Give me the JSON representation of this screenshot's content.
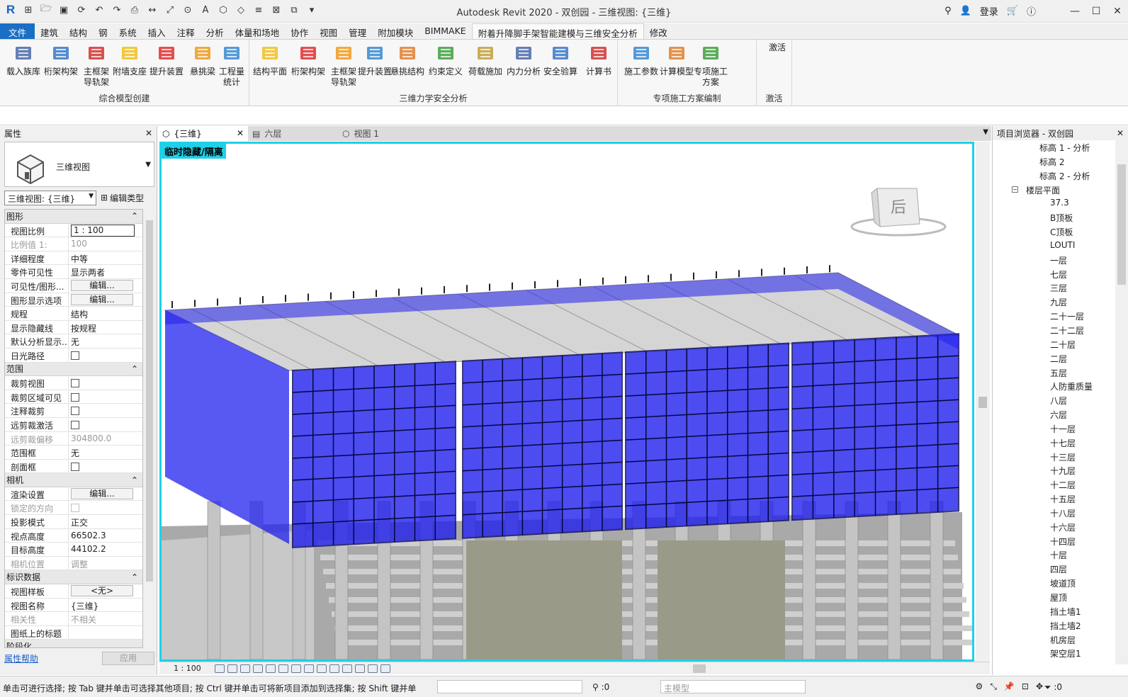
{
  "window": {
    "title": "Autodesk Revit 2020 - 双创园 - 三维视图: {三维}",
    "sign_in": "登录"
  },
  "tabs": [
    "文件",
    "建筑",
    "结构",
    "钢",
    "系统",
    "插入",
    "注释",
    "分析",
    "体量和场地",
    "协作",
    "视图",
    "管理",
    "附加模块",
    "BIMMAKE",
    "附着升降脚手架智能建模与三维安全分析",
    "修改"
  ],
  "ribbon": {
    "groups": [
      {
        "label": "综合模型创建",
        "tools": [
          "载入族库",
          "桁架构架",
          "主框架\n导轨架",
          "附墙支座",
          "提升装置",
          "悬挑梁",
          "工程量\n统计"
        ]
      },
      {
        "label": "三维力学安全分析",
        "tools": [
          "结构平面",
          "桁架构架",
          "主框架\n导轨架",
          "提升装置",
          "悬挑结构",
          "约束定义",
          "荷载施加",
          "内力分析",
          "安全验算",
          "计算书"
        ]
      },
      {
        "label": "专项施工方案编制",
        "tools": [
          "施工参数",
          "计算模型",
          "专项施工方案"
        ]
      },
      {
        "label": "激活",
        "tools": [
          "激活"
        ]
      }
    ]
  },
  "properties": {
    "title": "属性",
    "type_name": "三维视图",
    "instance_selector": "三维视图: {三维}",
    "edit_type": "编辑类型",
    "help": "属性帮助",
    "apply": "应用",
    "sections": [
      {
        "name": "图形",
        "rows": [
          {
            "name": "视图比例",
            "value": "1 : 100",
            "kind": "input"
          },
          {
            "name": "比例值 1:",
            "value": "100",
            "kind": "dim"
          },
          {
            "name": "详细程度",
            "value": "中等"
          },
          {
            "name": "零件可见性",
            "value": "显示两者"
          },
          {
            "name": "可见性/图形...",
            "value": "编辑...",
            "kind": "button"
          },
          {
            "name": "图形显示选项",
            "value": "编辑...",
            "kind": "button"
          },
          {
            "name": "规程",
            "value": "结构"
          },
          {
            "name": "显示隐藏线",
            "value": "按规程"
          },
          {
            "name": "默认分析显示...",
            "value": "无"
          },
          {
            "name": "日光路径",
            "value": "",
            "kind": "check"
          }
        ]
      },
      {
        "name": "范围",
        "rows": [
          {
            "name": "裁剪视图",
            "value": "",
            "kind": "check"
          },
          {
            "name": "裁剪区域可见",
            "value": "",
            "kind": "check"
          },
          {
            "name": "注释裁剪",
            "value": "",
            "kind": "check"
          },
          {
            "name": "远剪裁激活",
            "value": "",
            "kind": "check"
          },
          {
            "name": "远剪裁偏移",
            "value": "304800.0",
            "kind": "dim"
          },
          {
            "name": "范围框",
            "value": "无"
          },
          {
            "name": "剖面框",
            "value": "",
            "kind": "check"
          }
        ]
      },
      {
        "name": "相机",
        "rows": [
          {
            "name": "渲染设置",
            "value": "编辑...",
            "kind": "button"
          },
          {
            "name": "锁定的方向",
            "value": "",
            "kind": "dimcheck"
          },
          {
            "name": "投影模式",
            "value": "正交"
          },
          {
            "name": "视点高度",
            "value": "66502.3"
          },
          {
            "name": "目标高度",
            "value": "44102.2"
          },
          {
            "name": "相机位置",
            "value": "调整",
            "kind": "dim"
          }
        ]
      },
      {
        "name": "标识数据",
        "rows": [
          {
            "name": "视图样板",
            "value": "<无>",
            "kind": "button"
          },
          {
            "name": "视图名称",
            "value": "{三维}"
          },
          {
            "name": "相关性",
            "value": "不相关",
            "kind": "dim"
          },
          {
            "name": "图纸上的标题",
            "value": ""
          }
        ]
      },
      {
        "name": "阶段化",
        "rows": []
      }
    ]
  },
  "view_tabs": [
    {
      "label": "{三维}",
      "active": true
    },
    {
      "label": "六层",
      "active": false
    },
    {
      "label": "视图 1",
      "active": false
    }
  ],
  "viewport": {
    "banner": "临时隐藏/隔离",
    "viewcube_face": "后",
    "scale": "1 : 100"
  },
  "browser": {
    "title": "项目浏览器 - 双创园",
    "items": [
      {
        "label": "标高 1 - 分析",
        "level": 2
      },
      {
        "label": "标高 2",
        "level": 2
      },
      {
        "label": "标高 2 - 分析",
        "level": 2
      },
      {
        "label": "楼层平面",
        "level": 1,
        "expander": "−"
      },
      {
        "label": "37.3",
        "level": 3
      },
      {
        "label": "B顶板",
        "level": 3
      },
      {
        "label": "C顶板",
        "level": 3
      },
      {
        "label": "LOUTI",
        "level": 3
      },
      {
        "label": "一层",
        "level": 3
      },
      {
        "label": "七层",
        "level": 3
      },
      {
        "label": "三层",
        "level": 3
      },
      {
        "label": "九层",
        "level": 3
      },
      {
        "label": "二十一层",
        "level": 3
      },
      {
        "label": "二十二层",
        "level": 3
      },
      {
        "label": "二十层",
        "level": 3
      },
      {
        "label": "二层",
        "level": 3
      },
      {
        "label": "五层",
        "level": 3
      },
      {
        "label": "人防重质量",
        "level": 3
      },
      {
        "label": "八层",
        "level": 3
      },
      {
        "label": "六层",
        "level": 3
      },
      {
        "label": "十一层",
        "level": 3
      },
      {
        "label": "十七层",
        "level": 3
      },
      {
        "label": "十三层",
        "level": 3
      },
      {
        "label": "十九层",
        "level": 3
      },
      {
        "label": "十二层",
        "level": 3
      },
      {
        "label": "十五层",
        "level": 3
      },
      {
        "label": "十八层",
        "level": 3
      },
      {
        "label": "十六层",
        "level": 3
      },
      {
        "label": "十四层",
        "level": 3
      },
      {
        "label": "十层",
        "level": 3
      },
      {
        "label": "四层",
        "level": 3
      },
      {
        "label": "坡道顶",
        "level": 3
      },
      {
        "label": "屋顶",
        "level": 3
      },
      {
        "label": "挡土墙1",
        "level": 3
      },
      {
        "label": "挡土墙2",
        "level": 3
      },
      {
        "label": "机房层",
        "level": 3
      },
      {
        "label": "架空层1",
        "level": 3
      }
    ]
  },
  "status": {
    "message": "单击可进行选择; 按 Tab 键并单击可选择其他项目; 按 Ctrl 键并单击可将新项目添加到选择集; 按 Shift 键并单",
    "coord": ":0",
    "model": "主模型",
    "filter": ":0"
  },
  "colors": {
    "file_tab": "#1a6fc4",
    "viewport_border": "#1fd0e8",
    "scaffold_blue": "#2020ee",
    "concrete": "#b9b9b9"
  }
}
